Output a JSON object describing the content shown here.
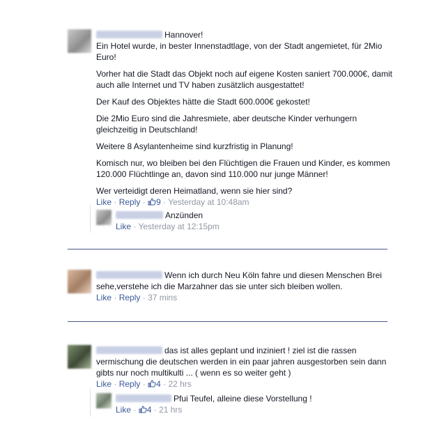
{
  "comment1": {
    "paragraphs": [
      "Hannover!\nEin Hotel wurde, in bester Innenstadtlage, von der Stadt angemietet, für 2Mio Euro!",
      "Vorher hat die Stadt das Objekt noch auf eigene Kosten saniert 700.000€, damit auch alle Internet und TV haben zusätzlich ausgestattet!",
      "Der Kauf des Objektes hätte die Stadt 600.000€ gekostet!",
      "Die 2Mio Euro sind die Jahresmiete, aber deutsche Kinder verhungern gleichzeitig in Deutschland!",
      "Weitere 8 Asylantenheime sind kurzfristig in Planung!",
      "Komisch nur, wo bleiben bei den Flüchtigen die Frauen und Kinder, es kommen 120.000 Flüchtlinge an, davon sind 110.000 nur junge Männer!",
      "Wer verteidigt deren Heimatland, wenn sie hier sind?"
    ],
    "like": "Like",
    "reply": "Reply",
    "sep": "·",
    "likes": "9",
    "time": "Yesterday at 10:48am"
  },
  "reply1": {
    "text": "Anzünden",
    "like": "Like",
    "sep": "·",
    "time": "Yesterday at 12:15pm"
  },
  "comment2": {
    "text": "Wenn ich durch Neu Köln fahre und diesen Menschen Brei sehe,verstehe ich die Marzahner das sie unter sich bleiben wollen.",
    "like": "Like",
    "reply": "Reply",
    "sep": "·",
    "time": "37 mins"
  },
  "comment3": {
    "text": "das ist alles geplant und inziniert ! ziel ist die rassen vermischung die deutschen werden in ein paar jahren ausgestorben sein dann gibts nur noch multikulti ... ( wenn es so weiter geht )",
    "like": "Like",
    "reply": "Reply",
    "sep": "·",
    "likes": "4",
    "time": "22 hrs"
  },
  "reply2": {
    "text": "Pfui Teufel, alleine diese Vorstellung !",
    "like": "Like",
    "sep": "·",
    "likes": "4",
    "time": "21 hrs"
  },
  "colors": {
    "link": "#3b5998",
    "meta": "#9197a3",
    "separator": "#4b5b8a"
  },
  "icons": {
    "like_count": "thumbs-up-icon"
  }
}
